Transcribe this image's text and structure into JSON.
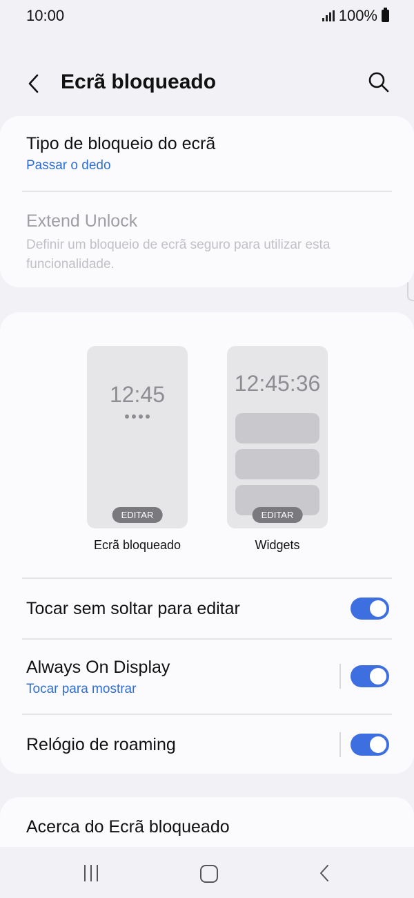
{
  "status": {
    "time": "10:00",
    "battery": "100%"
  },
  "header": {
    "title": "Ecrã bloqueado",
    "back_icon": "chevron-left-icon",
    "search_icon": "search-icon"
  },
  "lock_section": {
    "lock_type": {
      "title": "Tipo de bloqueio do ecrã",
      "value": "Passar o dedo"
    },
    "extend_unlock": {
      "title": "Extend Unlock",
      "description": "Definir um bloqueio de ecrã seguro para utilizar esta funcionalidade."
    }
  },
  "previews": {
    "lockscreen": {
      "clock": "12:45",
      "edit": "EDITAR",
      "label": "Ecrã bloqueado"
    },
    "widgets": {
      "clock": "12:45:36",
      "edit": "EDITAR",
      "label": "Widgets"
    }
  },
  "settings": {
    "touch_hold": {
      "title": "Tocar sem soltar para editar",
      "enabled": true
    },
    "aod": {
      "title": "Always On Display",
      "sub": "Tocar para mostrar",
      "enabled": true
    },
    "roaming_clock": {
      "title": "Relógio de roaming",
      "enabled": true
    }
  },
  "about": {
    "title": "Acerca do Ecrã bloqueado"
  },
  "navbar": {
    "recents_icon": "recents-icon",
    "home_icon": "home-icon",
    "back_icon": "back-icon"
  },
  "colors": {
    "accent": "#3d6fe0",
    "link": "#2f6ed3",
    "background": "#f2f2f6",
    "card": "#fbfbfe"
  }
}
